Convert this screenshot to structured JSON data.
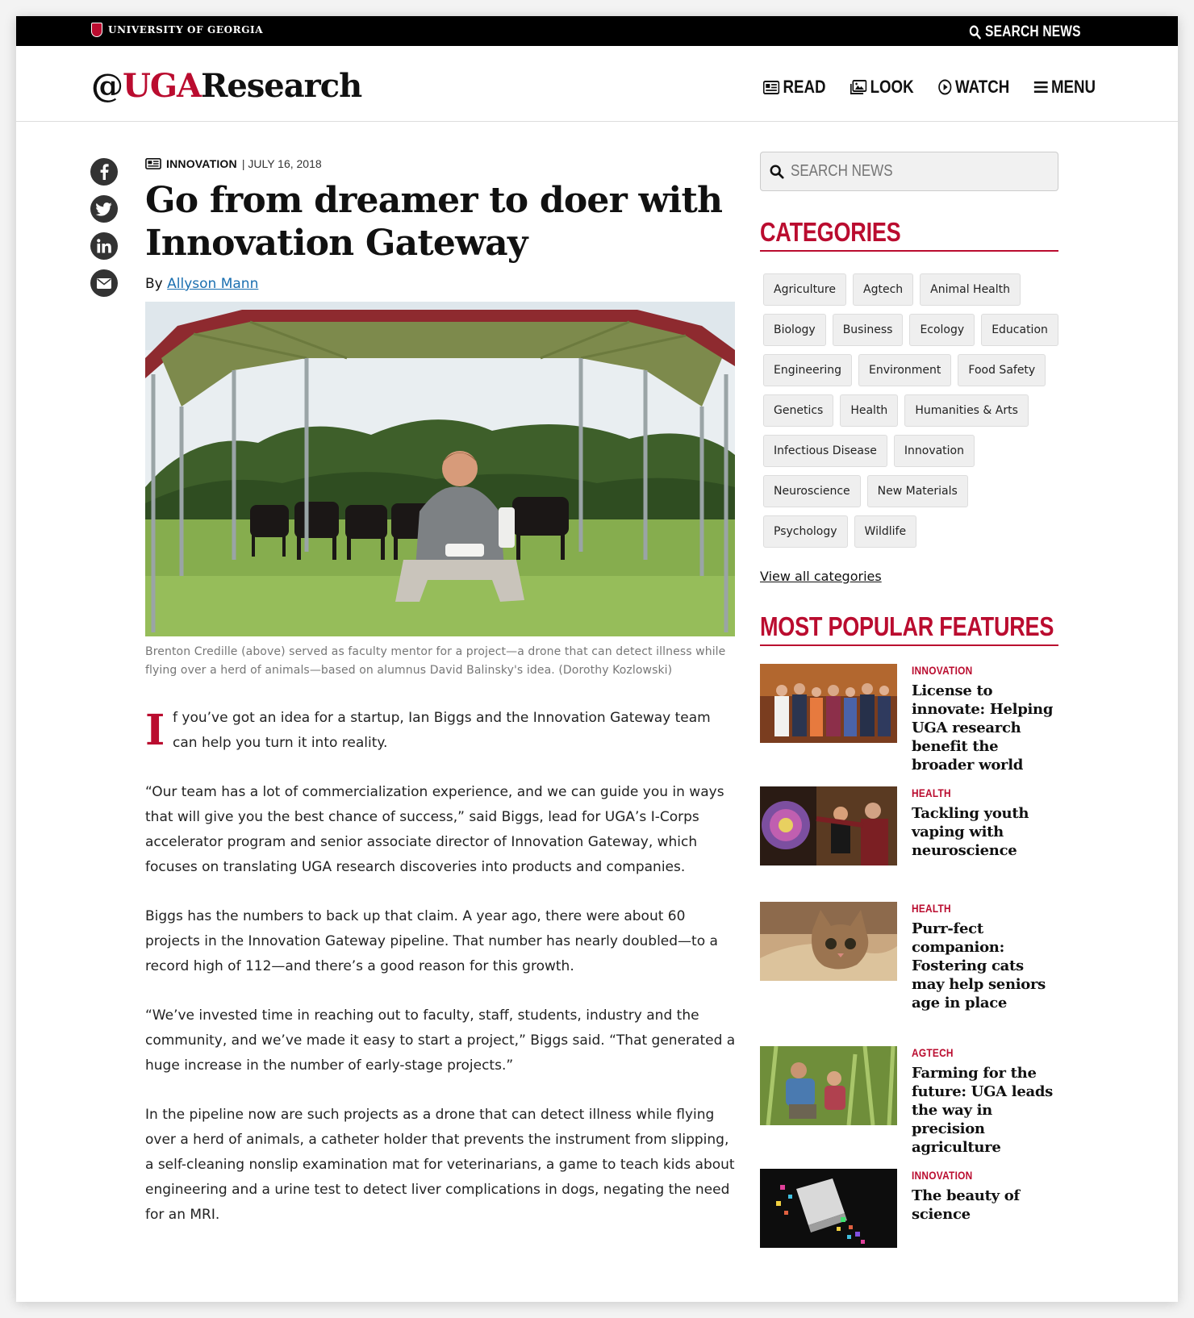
{
  "topbar": {
    "university": "UNIVERSITY OF GEORGIA",
    "search_label": "SEARCH NEWS"
  },
  "header": {
    "brand_at": "@",
    "brand_uga": "UGA",
    "brand_rest": "Research",
    "nav": [
      "READ",
      "LOOK",
      "WATCH",
      "MENU"
    ]
  },
  "article": {
    "category": "INNOVATION",
    "date": "| JULY 16, 2018",
    "title": "Go from dreamer to doer with Innovation Gateway",
    "by": "By",
    "author": "Allyson Mann",
    "caption": "Brenton Credille (above) served as faculty mentor for a project—a drone that can detect illness while flying over a herd of animals—based on alumnus David Balinsky's idea. (Dorothy Kozlowski)",
    "dropcap": "I",
    "lead_rest": "f you’ve got an idea for a startup, Ian Biggs and the Innovation Gateway team can help you turn it into reality.",
    "paragraphs": [
      "“Our team has a lot of commercialization experience, and we can guide you in ways that will give you the best chance of success,” said Biggs, lead for UGA’s I-Corps accelerator program and senior associate director of Innovation Gateway, which focuses on translating UGA research discoveries into products and companies.",
      "Biggs has the numbers to back up that claim. A year ago, there were about 60 projects in the Innovation Gateway pipeline. That number has nearly doubled—to a record high of 112—and there’s a good reason for this growth.",
      "“We’ve invested time in reaching out to faculty, staff, students, industry and the community, and we’ve made it easy to start a project,” Biggs said. “That generated a huge increase in the number of early-stage projects.”",
      "In the pipeline now are such projects as a drone that can detect illness while flying over a herd of animals, a catheter holder that prevents the instrument from slipping, a self-cleaning nonslip examination mat for veterinarians, a game to teach kids about engineering and a urine test to detect liver complications in dogs, negating the need for an MRI."
    ]
  },
  "sidebar": {
    "search_placeholder": "SEARCH NEWS",
    "categories_heading": "CATEGORIES",
    "categories": [
      "Agriculture",
      "Agtech",
      "Animal Health",
      "Biology",
      "Business",
      "Ecology",
      "Education",
      "Engineering",
      "Environment",
      "Food Safety",
      "Genetics",
      "Health",
      "Humanities & Arts",
      "Infectious Disease",
      "Innovation",
      "Neuroscience",
      "New Materials",
      "Psychology",
      "Wildlife"
    ],
    "view_all": "View all categories",
    "popular_heading": "MOST POPULAR FEATURES",
    "features": [
      {
        "category": "INNOVATION",
        "title": "License to innovate: Helping UGA research benefit the broader world"
      },
      {
        "category": "HEALTH",
        "title": "Tackling youth vaping with neuroscience"
      },
      {
        "category": "HEALTH",
        "title": "Purr-fect companion: Fostering cats may help seniors age in place"
      },
      {
        "category": "AGTECH",
        "title": "Farming for the future: UGA leads the way in precision agriculture"
      },
      {
        "category": "INNOVATION",
        "title": "The beauty of science"
      }
    ]
  },
  "colors": {
    "accent": "#ba0c2f",
    "topbar": "#000000",
    "link": "#1a6fb0"
  },
  "icons": [
    "search-icon",
    "newspaper-icon",
    "image-icon",
    "play-icon",
    "menu-icon",
    "facebook-icon",
    "twitter-icon",
    "linkedin-icon",
    "email-icon"
  ]
}
